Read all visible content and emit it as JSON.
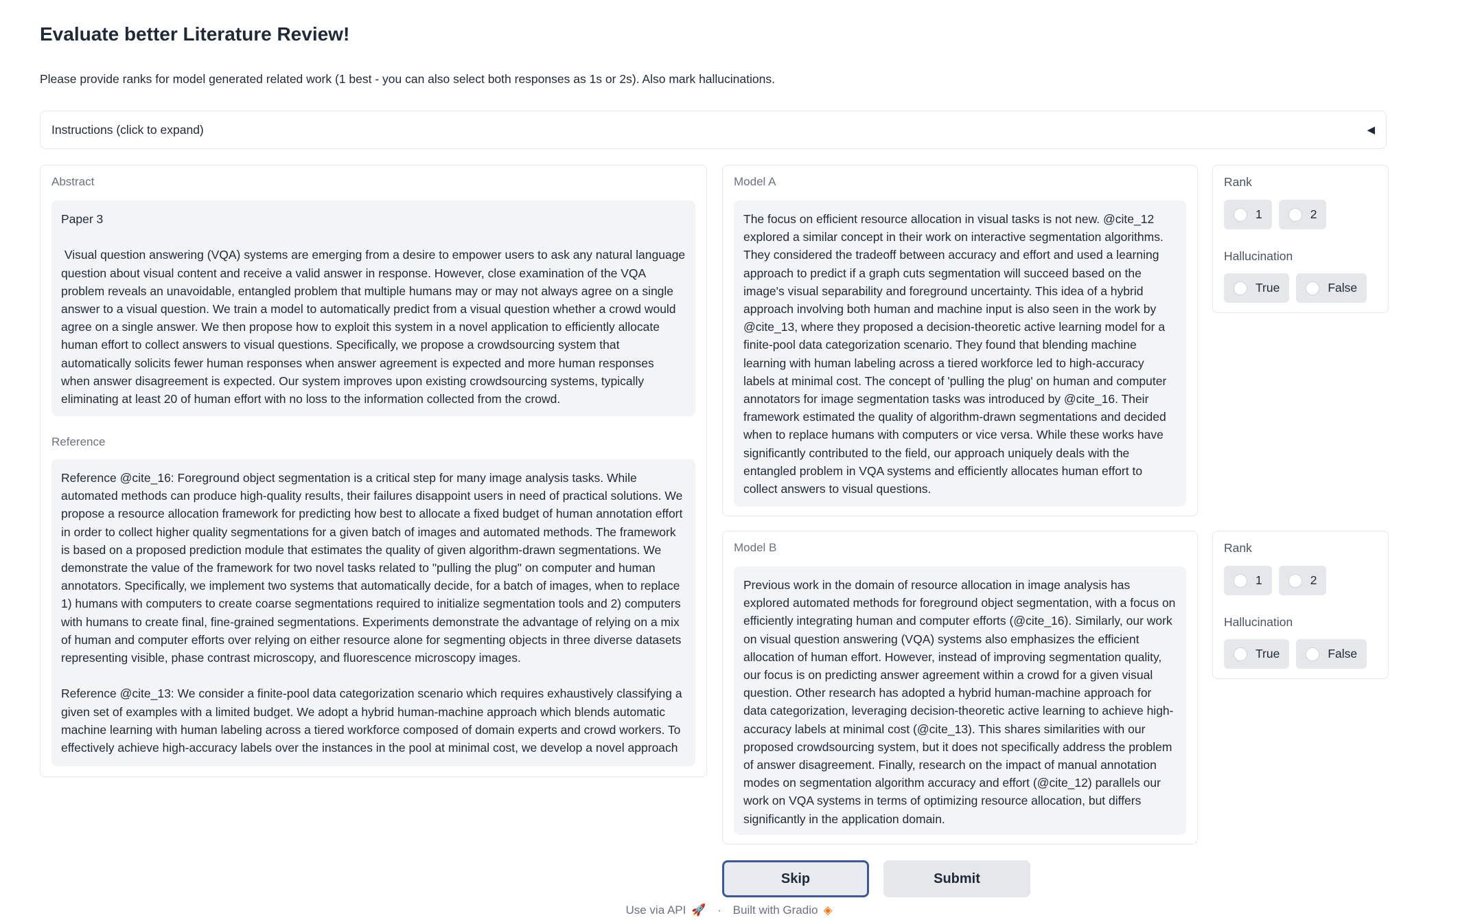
{
  "header": {
    "title": "Evaluate better Literature Review!",
    "subtitle": "Please provide ranks for model generated related work (1 best - you can also select both responses as 1s or 2s). Also mark hallucinations."
  },
  "instructions": {
    "label": "Instructions (click to expand)",
    "arrow": "◀"
  },
  "left": {
    "abstract_label": "Abstract",
    "abstract_text": "Paper 3\n\n Visual question answering (VQA) systems are emerging from a desire to empower users to ask any natural language question about visual content and receive a valid answer in response. However, close examination of the VQA problem reveals an unavoidable, entangled problem that multiple humans may or may not always agree on a single answer to a visual question. We train a model to automatically predict from a visual question whether a crowd would agree on a single answer. We then propose how to exploit this system in a novel application to efficiently allocate human effort to collect answers to visual questions. Specifically, we propose a crowdsourcing system that automatically solicits fewer human responses when answer agreement is expected and more human responses when answer disagreement is expected. Our system improves upon existing crowdsourcing systems, typically eliminating at least 20 of human effort with no loss to the information collected from the crowd.",
    "reference_label": "Reference",
    "reference_text": "Reference @cite_16: Foreground object segmentation is a critical step for many image analysis tasks. While automated methods can produce high-quality results, their failures disappoint users in need of practical solutions. We propose a resource allocation framework for predicting how best to allocate a fixed budget of human annotation effort in order to collect higher quality segmentations for a given batch of images and automated methods. The framework is based on a proposed prediction module that estimates the quality of given algorithm-drawn segmentations. We demonstrate the value of the framework for two novel tasks related to \"pulling the plug\" on computer and human annotators. Specifically, we implement two systems that automatically decide, for a batch of images, when to replace 1) humans with computers to create coarse segmentations required to initialize segmentation tools and 2) computers with humans to create final, fine-grained segmentations. Experiments demonstrate the advantage of relying on a mix of human and computer efforts over relying on either resource alone for segmenting objects in three diverse datasets representing visible, phase contrast microscopy, and fluorescence microscopy images.\n\nReference @cite_13: We consider a finite-pool data categorization scenario which requires exhaustively classifying a given set of examples with a limited budget. We adopt a hybrid human-machine approach which blends automatic machine learning with human labeling across a tiered workforce composed of domain experts and crowd workers. To effectively achieve high-accuracy labels over the instances in the pool at minimal cost, we develop a novel approach"
  },
  "model_a": {
    "label": "Model A",
    "text": "The focus on efficient resource allocation in visual tasks is not new. @cite_12 explored a similar concept in their work on interactive segmentation algorithms. They considered the tradeoff between accuracy and effort and used a learning approach to predict if a graph cuts segmentation will succeed based on the image's visual separability and foreground uncertainty. This idea of a hybrid approach involving both human and machine input is also seen in the work by @cite_13, where they proposed a decision-theoretic active learning model for a finite-pool data categorization scenario. They found that blending machine learning with human labeling across a tiered workforce led to high-accuracy labels at minimal cost. The concept of 'pulling the plug' on human and computer annotators for image segmentation tasks was introduced by @cite_16. Their framework estimated the quality of algorithm-drawn segmentations and decided when to replace humans with computers or vice versa. While these works have significantly contributed to the field, our approach uniquely deals with the entangled problem in VQA systems and efficiently allocates human effort to collect answers to visual questions."
  },
  "model_b": {
    "label": "Model B",
    "text": "Previous work in the domain of resource allocation in image analysis has explored automated methods for foreground object segmentation, with a focus on efficiently integrating human and computer efforts (@cite_16). Similarly, our work on visual question answering (VQA) systems also emphasizes the efficient allocation of human effort. However, instead of improving segmentation quality, our focus is on predicting answer agreement within a crowd for a given visual question. Other research has adopted a hybrid human-machine approach for data categorization, leveraging decision-theoretic active learning to achieve high-accuracy labels at minimal cost (@cite_13). This shares similarities with our proposed crowdsourcing system, but it does not specifically address the problem of answer disagreement. Finally, research on the impact of manual annotation modes on segmentation algorithm accuracy and effort (@cite_12) parallels our work on VQA systems in terms of optimizing resource allocation, but differs significantly in the application domain."
  },
  "side_a": {
    "rank_label": "Rank",
    "rank_options": [
      "1",
      "2"
    ],
    "hallucination_label": "Hallucination",
    "hallucination_options": [
      "True",
      "False"
    ]
  },
  "side_b": {
    "rank_label": "Rank",
    "rank_options": [
      "1",
      "2"
    ],
    "hallucination_label": "Hallucination",
    "hallucination_options": [
      "True",
      "False"
    ]
  },
  "buttons": {
    "skip": "Skip",
    "submit": "Submit"
  },
  "footer": {
    "api": "Use via API",
    "dot": "·",
    "built": "Built with Gradio",
    "api_icon": "rocket-icon",
    "gradio_icon": "gradio-logo-icon"
  }
}
